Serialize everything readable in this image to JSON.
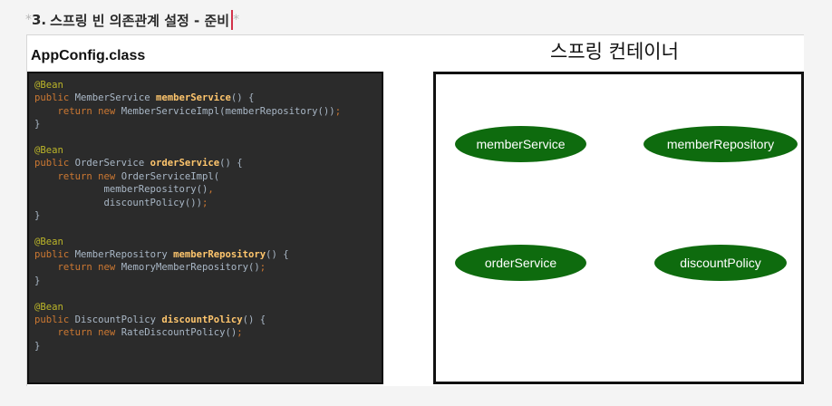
{
  "heading": {
    "star": "*",
    "number": "3.",
    "title": "스프링 빈 의존관계 설정 - 준비",
    "star_end": "*"
  },
  "code_panel": {
    "title": "AppConfig.class",
    "lines": [
      [
        {
          "t": "ann",
          "v": "@Bean"
        }
      ],
      [
        {
          "t": "kw",
          "v": "public "
        },
        {
          "t": "plain",
          "v": "MemberService "
        },
        {
          "t": "fn",
          "v": "memberService"
        },
        {
          "t": "plain",
          "v": "() {"
        }
      ],
      [
        {
          "t": "plain",
          "v": "    "
        },
        {
          "t": "kw",
          "v": "return new "
        },
        {
          "t": "plain",
          "v": "MemberServiceImpl(memberRepository())"
        },
        {
          "t": "kw",
          "v": ";"
        }
      ],
      [
        {
          "t": "plain",
          "v": "}"
        }
      ],
      [
        {
          "t": "plain",
          "v": ""
        }
      ],
      [
        {
          "t": "ann",
          "v": "@Bean"
        }
      ],
      [
        {
          "t": "kw",
          "v": "public "
        },
        {
          "t": "plain",
          "v": "OrderService "
        },
        {
          "t": "fn",
          "v": "orderService"
        },
        {
          "t": "plain",
          "v": "() {"
        }
      ],
      [
        {
          "t": "plain",
          "v": "    "
        },
        {
          "t": "kw",
          "v": "return new "
        },
        {
          "t": "plain",
          "v": "OrderServiceImpl("
        }
      ],
      [
        {
          "t": "plain",
          "v": "            memberRepository()"
        },
        {
          "t": "kw",
          "v": ","
        }
      ],
      [
        {
          "t": "plain",
          "v": "            discountPolicy())"
        },
        {
          "t": "kw",
          "v": ";"
        }
      ],
      [
        {
          "t": "plain",
          "v": "}"
        }
      ],
      [
        {
          "t": "plain",
          "v": ""
        }
      ],
      [
        {
          "t": "ann",
          "v": "@Bean"
        }
      ],
      [
        {
          "t": "kw",
          "v": "public "
        },
        {
          "t": "plain",
          "v": "MemberRepository "
        },
        {
          "t": "fn",
          "v": "memberRepository"
        },
        {
          "t": "plain",
          "v": "() {"
        }
      ],
      [
        {
          "t": "plain",
          "v": "    "
        },
        {
          "t": "kw",
          "v": "return new "
        },
        {
          "t": "plain",
          "v": "MemoryMemberRepository()"
        },
        {
          "t": "kw",
          "v": ";"
        }
      ],
      [
        {
          "t": "plain",
          "v": "}"
        }
      ],
      [
        {
          "t": "plain",
          "v": ""
        }
      ],
      [
        {
          "t": "ann",
          "v": "@Bean"
        }
      ],
      [
        {
          "t": "kw",
          "v": "public "
        },
        {
          "t": "plain",
          "v": "DiscountPolicy "
        },
        {
          "t": "fn",
          "v": "discountPolicy"
        },
        {
          "t": "plain",
          "v": "() {"
        }
      ],
      [
        {
          "t": "plain",
          "v": "    "
        },
        {
          "t": "kw",
          "v": "return new "
        },
        {
          "t": "plain",
          "v": "RateDiscountPolicy()"
        },
        {
          "t": "kw",
          "v": ";"
        }
      ],
      [
        {
          "t": "plain",
          "v": "}"
        }
      ]
    ]
  },
  "container": {
    "title": "스프링 컨테이너",
    "beans": [
      {
        "label": "memberService"
      },
      {
        "label": "memberRepository"
      },
      {
        "label": "orderService"
      },
      {
        "label": "discountPolicy"
      }
    ]
  },
  "colors": {
    "bean_fill": "#0e6b0e",
    "code_bg": "#2b2b2b",
    "annotation": "#bbb529",
    "keyword": "#cc7832",
    "method_name": "#ffc66d"
  }
}
